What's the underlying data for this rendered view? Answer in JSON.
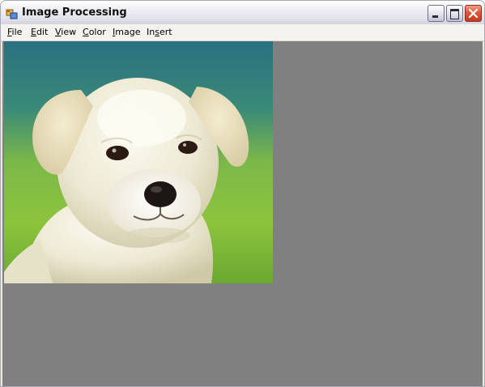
{
  "window": {
    "title": "Image Processing",
    "icon": "app-window-icon"
  },
  "caption_buttons": [
    {
      "name": "minimize",
      "icon": "minimize-icon"
    },
    {
      "name": "maximize",
      "icon": "maximize-icon"
    },
    {
      "name": "close",
      "icon": "close-icon"
    }
  ],
  "menu": {
    "items": [
      {
        "label": "File",
        "mnemonic": "F"
      },
      {
        "label": "Edit",
        "mnemonic": "E"
      },
      {
        "label": "View",
        "mnemonic": "V"
      },
      {
        "label": "Color",
        "mnemonic": "C"
      },
      {
        "label": "Image",
        "mnemonic": "I"
      },
      {
        "label": "Insert",
        "mnemonic": "s"
      }
    ]
  },
  "canvas": {
    "background": "#808080",
    "image_subject": "puppy-photo"
  },
  "colors": {
    "client_bg": "#808080",
    "close_button": "#e0553a"
  }
}
